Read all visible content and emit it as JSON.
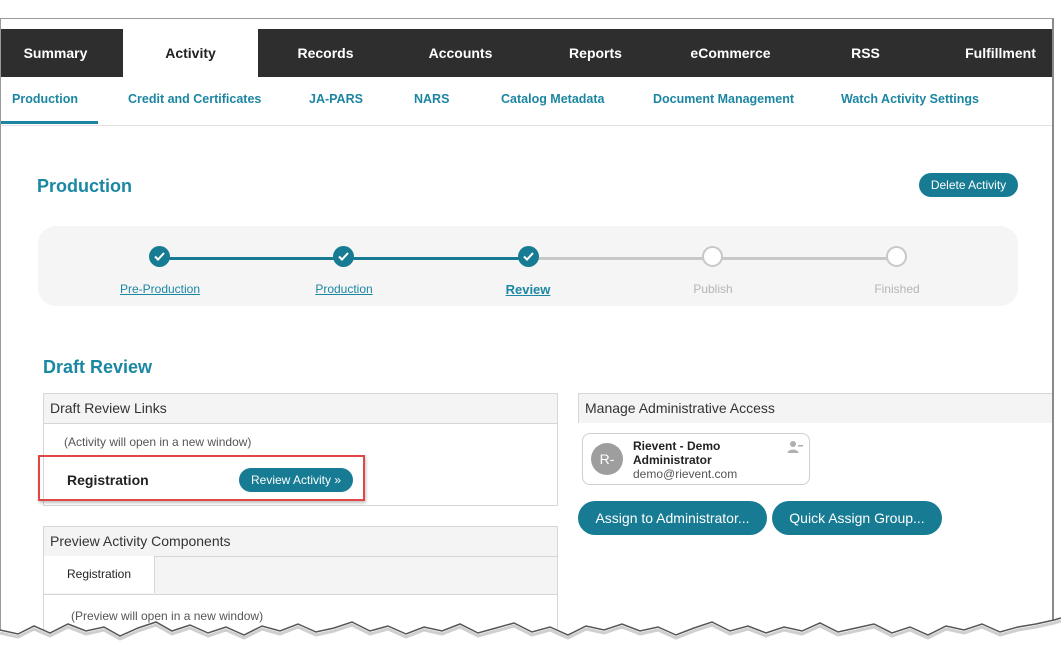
{
  "topnav": {
    "tabs": [
      {
        "label": "Summary"
      },
      {
        "label": "Activity"
      },
      {
        "label": "Records"
      },
      {
        "label": "Accounts"
      },
      {
        "label": "Reports"
      },
      {
        "label": "eCommerce"
      },
      {
        "label": "RSS"
      },
      {
        "label": "Fulfillment"
      }
    ],
    "active": "Activity"
  },
  "subnav": {
    "items": [
      {
        "label": "Production"
      },
      {
        "label": "Credit and Certificates"
      },
      {
        "label": "JA-PARS"
      },
      {
        "label": "NARS"
      },
      {
        "label": "Catalog Metadata"
      },
      {
        "label": "Document Management"
      },
      {
        "label": "Watch Activity Settings"
      }
    ],
    "active": "Production"
  },
  "page": {
    "title": "Production",
    "delete_label": "Delete Activity"
  },
  "stepper": {
    "steps": [
      {
        "label": "Pre-Production",
        "state": "done"
      },
      {
        "label": "Production",
        "state": "done"
      },
      {
        "label": "Review",
        "state": "current"
      },
      {
        "label": "Publish",
        "state": "todo"
      },
      {
        "label": "Finished",
        "state": "todo"
      }
    ]
  },
  "draft_review": {
    "title": "Draft Review",
    "links_panel": {
      "header": "Draft Review Links",
      "note": "(Activity will open in a new window)",
      "row_label": "Registration",
      "button_label": "Review Activity »"
    },
    "preview_panel": {
      "header": "Preview Activity Components",
      "tab_label": "Registration",
      "note": "(Preview will open in a new window)"
    }
  },
  "admin_access": {
    "header": "Manage Administrative Access",
    "user": {
      "initials": "R-",
      "name": "Rievent - Demo Administrator",
      "email": "demo@rievent.com"
    },
    "assign_label": "Assign to Administrator...",
    "quick_assign_label": "Quick Assign Group..."
  },
  "colors": {
    "accent": "#167b93",
    "link": "#1a87a3",
    "nav_bg": "#2e2e2e",
    "highlight": "#e04646"
  }
}
